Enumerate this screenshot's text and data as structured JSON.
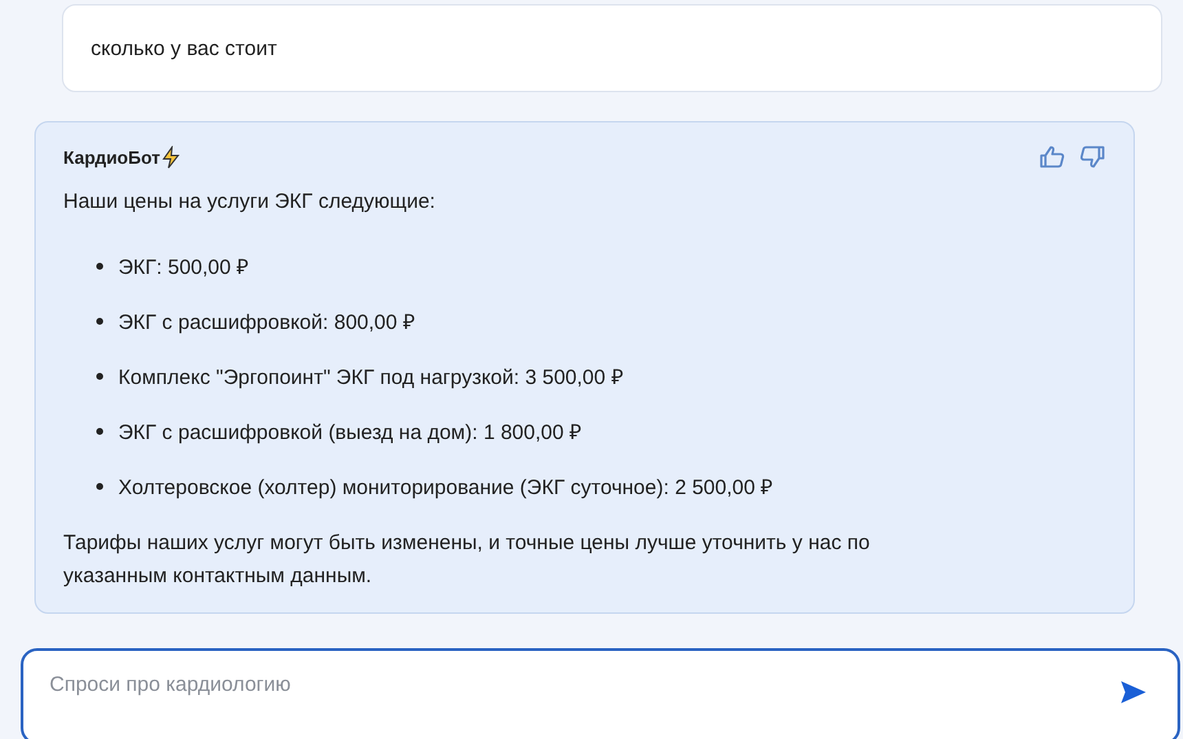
{
  "user_message": {
    "text": "сколько у вас стоит"
  },
  "bot_message": {
    "author": "КардиоБот",
    "intro": "Наши цены на услуги ЭКГ следующие:",
    "items": [
      "ЭКГ: 500,00 ₽",
      "ЭКГ с расшифровкой: 800,00 ₽",
      "Комплекс \"Эргопоинт\" ЭКГ под нагрузкой: 3 500,00 ₽",
      "ЭКГ с расшифровкой (выезд на дом): 1 800,00 ₽",
      "Холтеровское (холтер) мониторирование (ЭКГ суточное): 2 500,00 ₽"
    ],
    "outro": "Тарифы наших услуг могут быть изменены, и точные цены лучше уточнить у нас по указанным контактным данным."
  },
  "input": {
    "placeholder": "Спроси про кардиологию"
  }
}
